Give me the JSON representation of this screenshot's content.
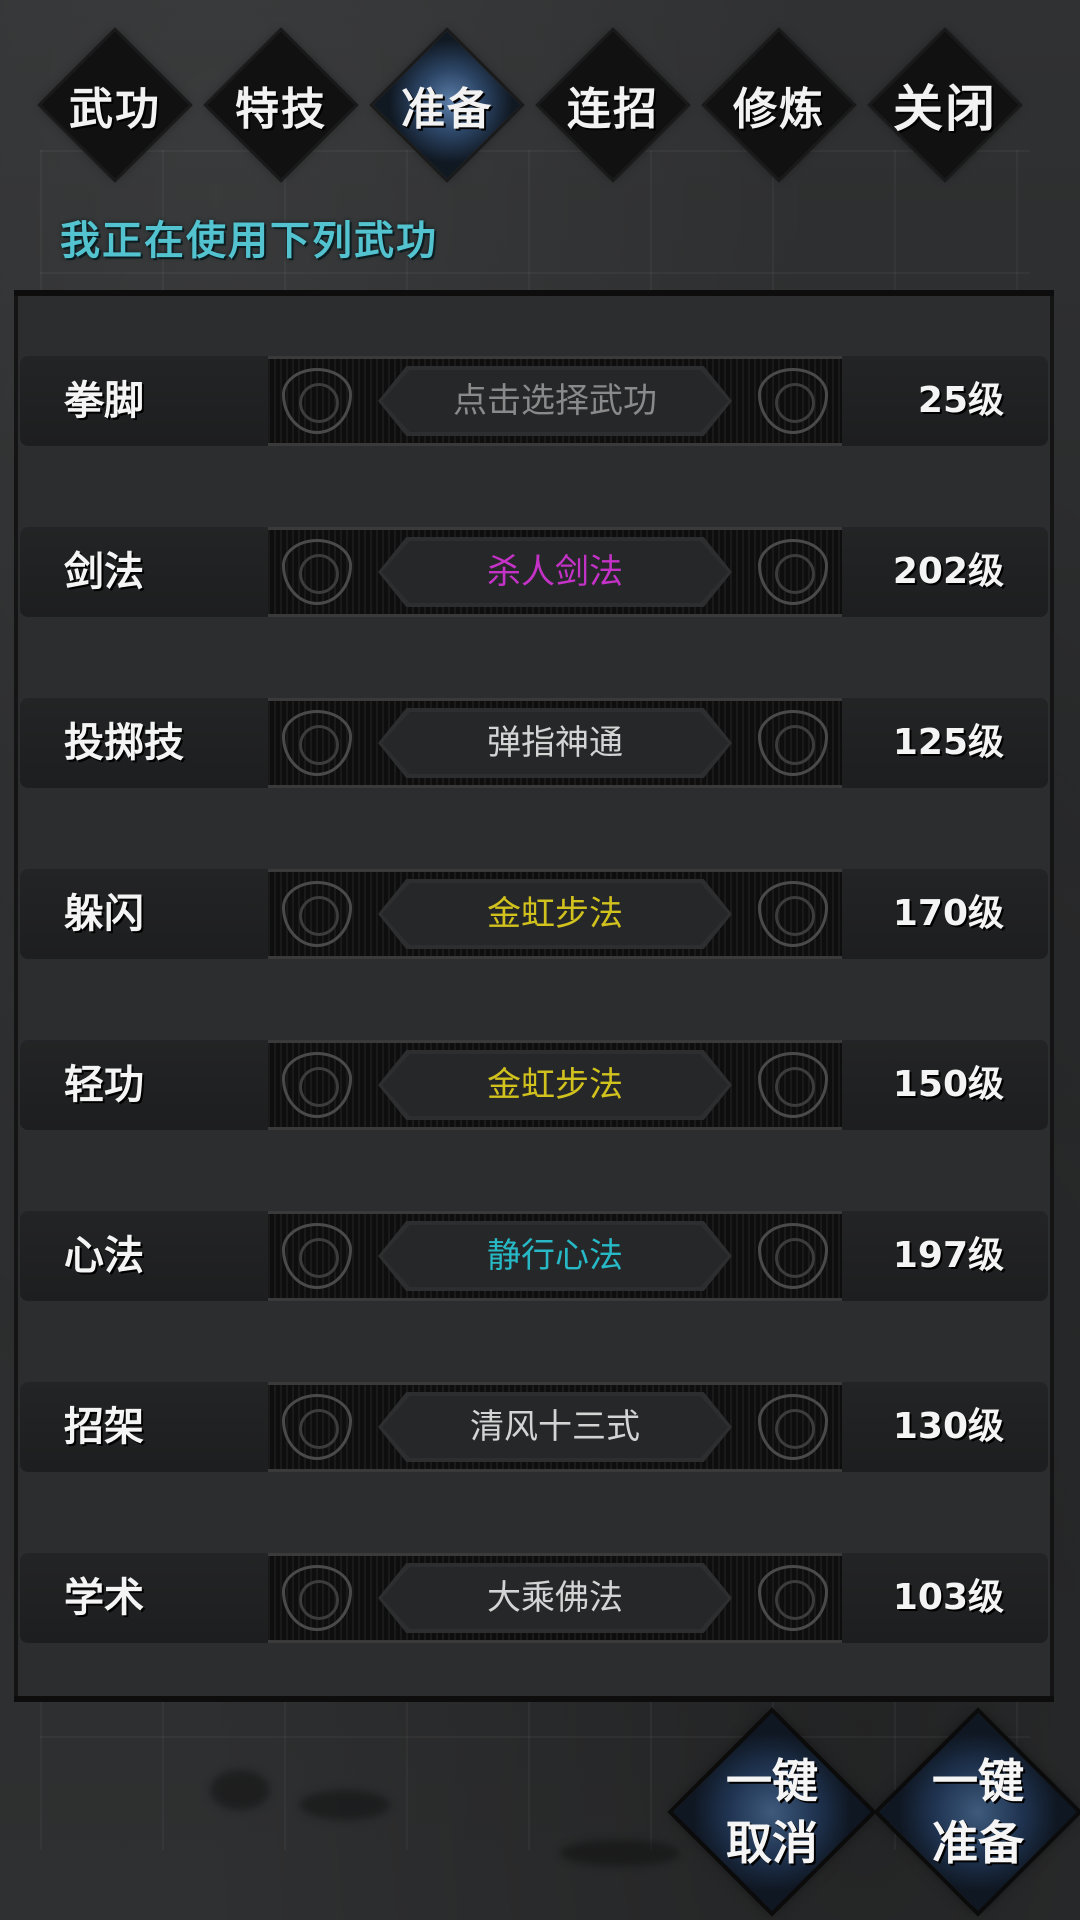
{
  "tabs": [
    {
      "label": "武功",
      "active": false
    },
    {
      "label": "特技",
      "active": false
    },
    {
      "label": "准备",
      "active": true
    },
    {
      "label": "连招",
      "active": false
    },
    {
      "label": "修炼",
      "active": false
    },
    {
      "label": "关闭",
      "active": false
    }
  ],
  "heading": "我正在使用下列武功",
  "rows": [
    {
      "category": "拳脚",
      "skill": "点击选择武功",
      "skill_color": "#8a8a8a",
      "level": "25级"
    },
    {
      "category": "剑法",
      "skill": "杀人剑法",
      "skill_color": "#c532c8",
      "level": "202级"
    },
    {
      "category": "投掷技",
      "skill": "弹指神通",
      "skill_color": "#d4d4d4",
      "level": "125级"
    },
    {
      "category": "躲闪",
      "skill": "金虹步法",
      "skill_color": "#d2c21d",
      "level": "170级"
    },
    {
      "category": "轻功",
      "skill": "金虹步法",
      "skill_color": "#d2c21d",
      "level": "150级"
    },
    {
      "category": "心法",
      "skill": "静行心法",
      "skill_color": "#27b9c6",
      "level": "197级"
    },
    {
      "category": "招架",
      "skill": "清风十三式",
      "skill_color": "#d4d4d4",
      "level": "130级"
    },
    {
      "category": "学术",
      "skill": "大乘佛法",
      "skill_color": "#d4d4d4",
      "level": "103级"
    }
  ],
  "buttons": {
    "cancel_all": "一键\n取消",
    "prepare_all": "一键\n准备"
  },
  "colors": {
    "heading": "#53c3d0",
    "active_tab": "#2d4768"
  }
}
